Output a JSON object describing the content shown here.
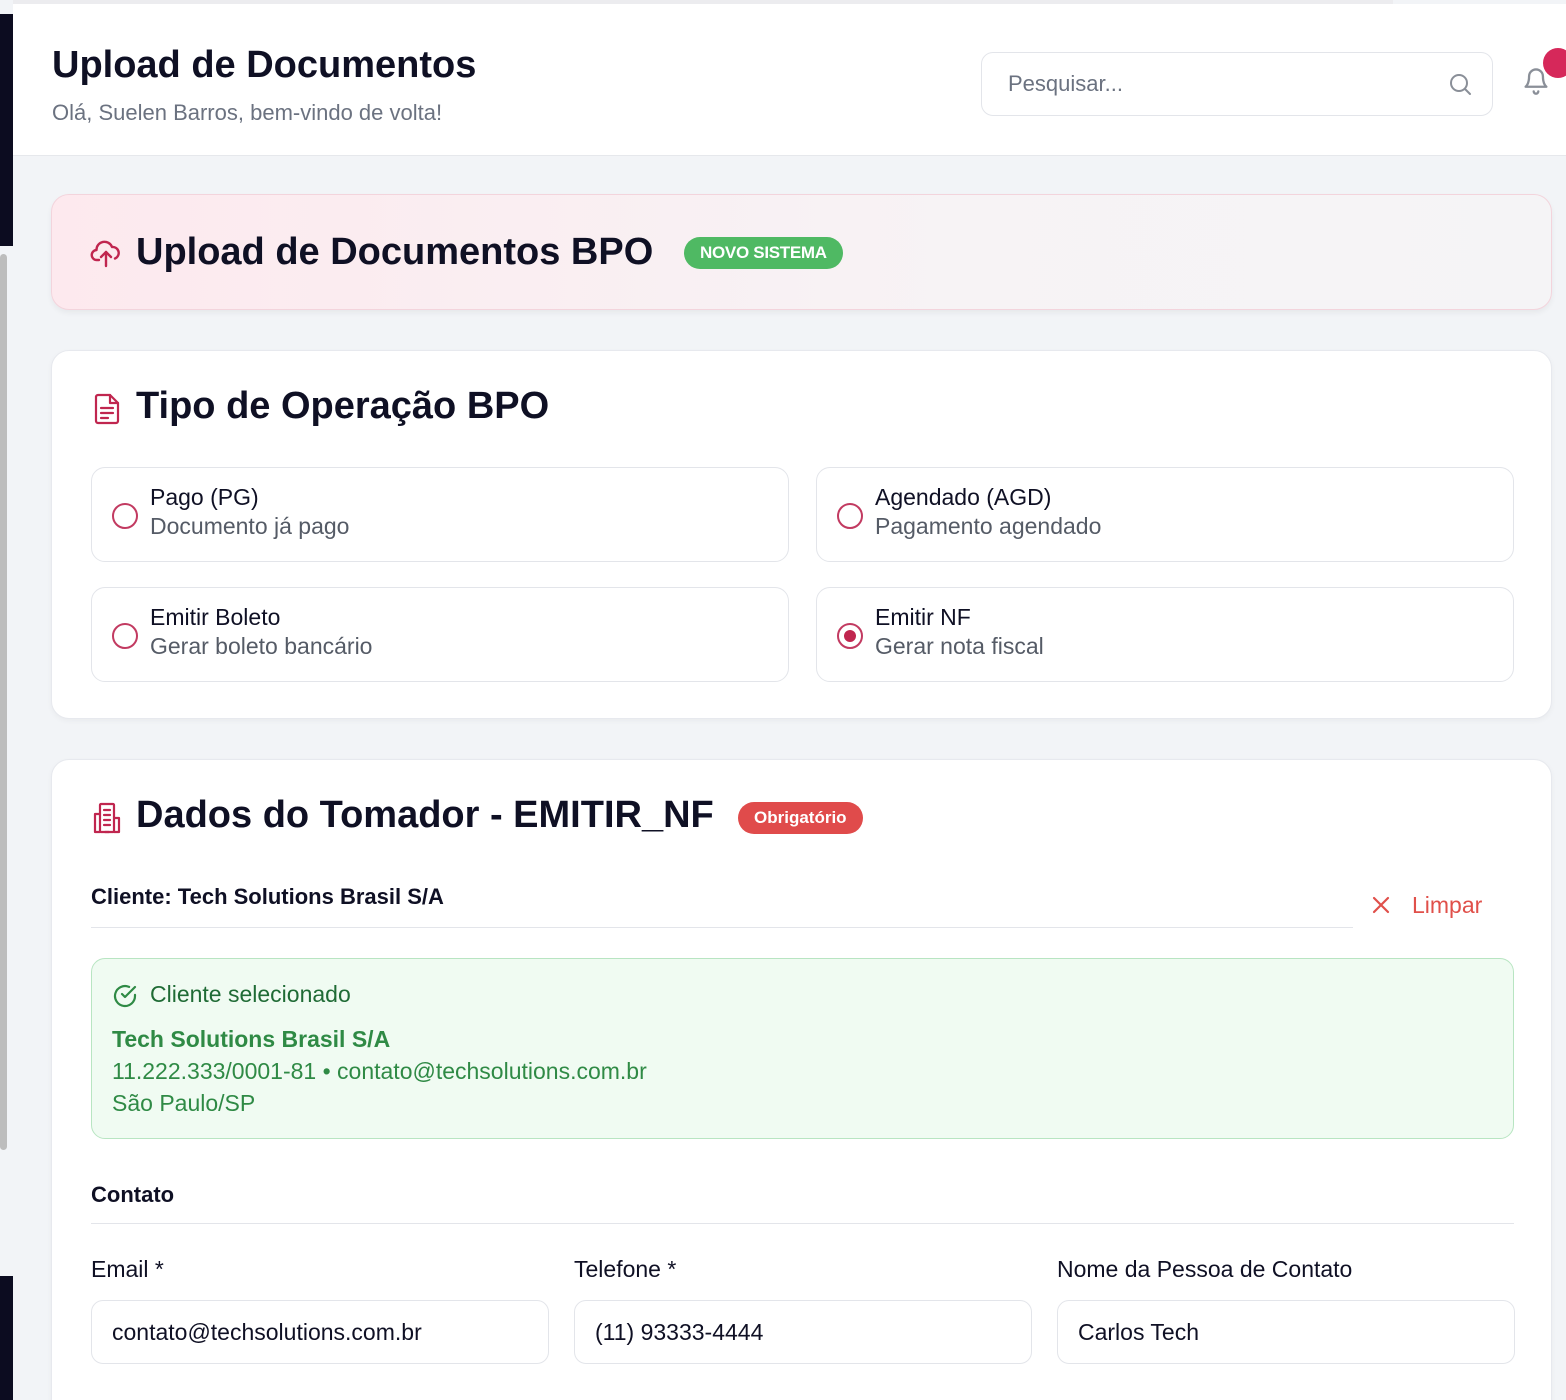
{
  "header": {
    "title": "Upload de Documentos",
    "subtitle": "Olá, Suelen Barros, bem-vindo de volta!",
    "search_placeholder": "Pesquisar..."
  },
  "banner": {
    "title": "Upload de Documentos BPO",
    "badge": "NOVO SISTEMA"
  },
  "operation": {
    "title": "Tipo de Operação BPO",
    "options": [
      {
        "label": "Pago (PG)",
        "description": "Documento já pago",
        "selected": false
      },
      {
        "label": "Agendado (AGD)",
        "description": "Pagamento agendado",
        "selected": false
      },
      {
        "label": "Emitir Boleto",
        "description": "Gerar boleto bancário",
        "selected": false
      },
      {
        "label": "Emitir NF",
        "description": "Gerar nota fiscal",
        "selected": true
      }
    ]
  },
  "tomador": {
    "title": "Dados do Tomador - EMITIR_NF",
    "badge": "Obrigatório",
    "client_label": "Cliente: Tech Solutions Brasil S/A",
    "clear_label": "Limpar",
    "selected": {
      "heading": "Cliente selecionado",
      "name": "Tech Solutions Brasil S/A",
      "meta": "11.222.333/0001-81 • contato@techsolutions.com.br",
      "city": "São Paulo/SP"
    },
    "contact_section": "Contato",
    "fields": {
      "email_label": "Email *",
      "email_value": "contato@techsolutions.com.br",
      "phone_label": "Telefone *",
      "phone_value": "(11) 93333-4444",
      "contact_name_label": "Nome da Pessoa de Contato",
      "contact_name_value": "Carlos Tech"
    }
  },
  "colors": {
    "accent": "#c0264f",
    "badge_green": "#4fb963",
    "badge_red": "#e04b4b",
    "success_text": "#2f8a45"
  },
  "icons": {
    "search": "search-icon",
    "bell": "bell-icon",
    "upload": "cloud-upload-icon",
    "document": "document-icon",
    "building": "building-icon",
    "clear": "close-icon",
    "check": "check-circle-icon"
  }
}
